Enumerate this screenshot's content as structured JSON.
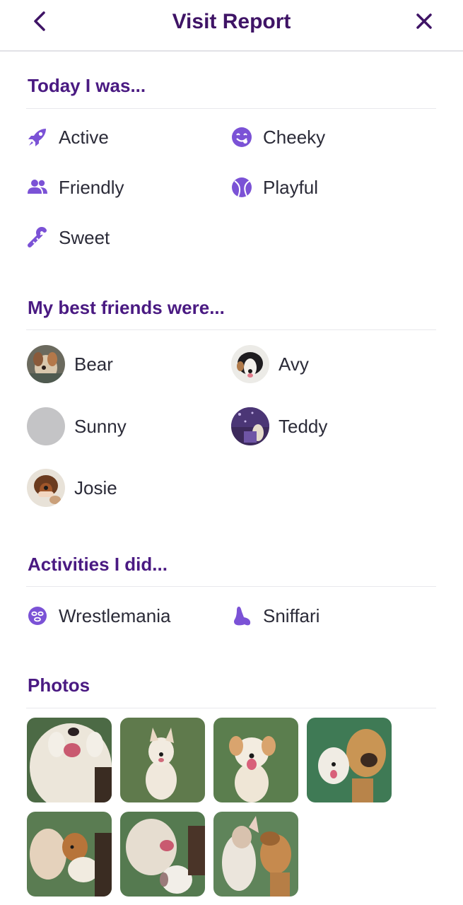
{
  "header": {
    "title": "Visit Report",
    "back_icon": "chevron-left-icon",
    "close_icon": "close-icon"
  },
  "colors": {
    "accent": "#4a1a82",
    "icon": "#7b52d6",
    "title": "#3f1466",
    "divider": "#e8e8ec"
  },
  "moods": {
    "title": "Today I was...",
    "items": [
      {
        "label": "Active",
        "icon": "rocket-icon"
      },
      {
        "label": "Cheeky",
        "icon": "cheeky-face-icon"
      },
      {
        "label": "Friendly",
        "icon": "users-icon"
      },
      {
        "label": "Playful",
        "icon": "ball-icon"
      },
      {
        "label": "Sweet",
        "icon": "candy-cane-icon"
      }
    ]
  },
  "friends": {
    "title": "My best friends were...",
    "items": [
      {
        "name": "Bear"
      },
      {
        "name": "Avy"
      },
      {
        "name": "Sunny"
      },
      {
        "name": "Teddy"
      },
      {
        "name": "Josie"
      }
    ]
  },
  "activities": {
    "title": "Activities I did...",
    "items": [
      {
        "label": "Wrestlemania",
        "icon": "wrestler-mask-icon"
      },
      {
        "label": "Sniffari",
        "icon": "nose-icon"
      }
    ]
  },
  "photos": {
    "title": "Photos",
    "count": 7
  }
}
